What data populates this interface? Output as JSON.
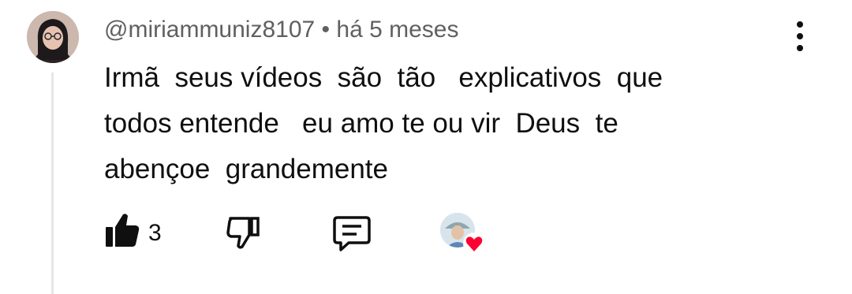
{
  "comment": {
    "author": "@miriammuniz8107",
    "separator": " • ",
    "time": "há 5 meses",
    "text": "Irmã  seus vídeos  são  tão   explicativos  que\ntodos entende   eu amo te ou vir  Deus  te\nabençoe  grandemente",
    "likes": "3"
  },
  "icons": {
    "menu": "more-vertical-icon",
    "like": "thumb-up-filled-icon",
    "dislike": "thumb-down-outline-icon",
    "reply": "comment-reply-icon",
    "heart": "creator-heart-icon"
  },
  "colors": {
    "meta_text": "#606060",
    "body_text": "#0f0f0f",
    "heart": "#ff0033",
    "thread_line": "#e6e6e6"
  }
}
